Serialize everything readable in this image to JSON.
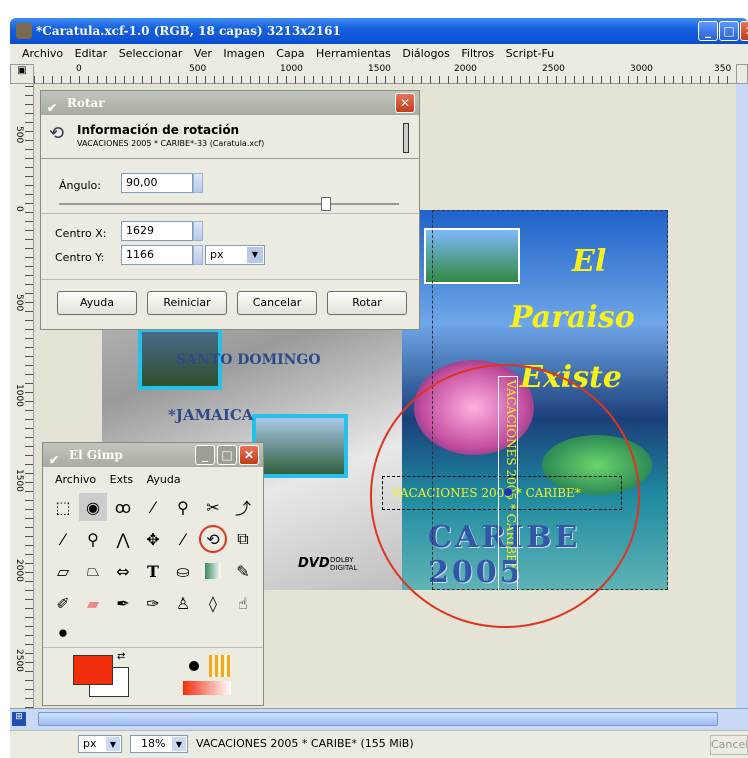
{
  "window": {
    "title": "*Caratula.xcf-1.0 (RGB, 18 capas) 3213x2161"
  },
  "menu": [
    "Archivo",
    "Editar",
    "Seleccionar",
    "Ver",
    "Imagen",
    "Capa",
    "Herramientas",
    "Diálogos",
    "Filtros",
    "Script-Fu"
  ],
  "ruler": {
    "h_ticks": [
      "0",
      "500",
      "1000",
      "1500",
      "2000",
      "2500",
      "3000",
      "350"
    ],
    "v_labels": [
      "500",
      "0",
      "500",
      "1000",
      "1500",
      "2000",
      "2500"
    ]
  },
  "rotate": {
    "title": "Rotar",
    "header": "Información de rotación",
    "subtitle": "VACACIONES 2005  * CARIBE*-33 (Caratula.xcf)",
    "angle_label": "Ángulo:",
    "angle_value": "90,00",
    "cx_label": "Centro X:",
    "cx_value": "1629",
    "cy_label": "Centro Y:",
    "cy_value": "1166",
    "unit": "px",
    "btn_help": "Ayuda",
    "btn_reset": "Reiniciar",
    "btn_cancel": "Cancelar",
    "btn_rotate": "Rotar"
  },
  "toolbox": {
    "title": "El Gimp",
    "menu": [
      "Archivo",
      "Exts",
      "Ayuda"
    ]
  },
  "image_text": {
    "santo": "SANTO DOMINGO",
    "jamaica": "*JAMAICA",
    "el": "El",
    "paraiso": "Paraiso",
    "existe": "Existe",
    "vac_h": "VACACIONES 2005  * CARIBE*",
    "vac_v": "VACACIONES 2005 * CARIBE*",
    "caribe": "CARIBE 2005",
    "dvd": "DVD",
    "dolby": "DOLBY DIGITAL"
  },
  "status": {
    "unit": "px",
    "zoom": "18%",
    "info": "VACACIONES 2005  * CARIBE* (155 MiB)",
    "cancel": "Cancelar"
  }
}
